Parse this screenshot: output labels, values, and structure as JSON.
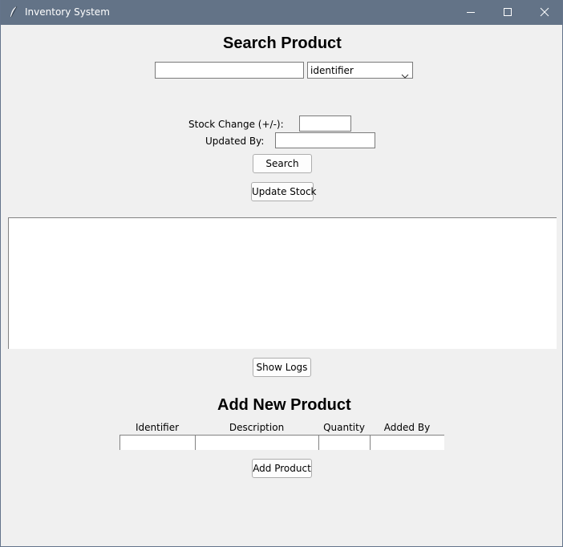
{
  "window": {
    "title": "Inventory System",
    "minimize_icon": "minimize-icon",
    "maximize_icon": "maximize-icon",
    "close_icon": "close-icon",
    "app_icon": "feather-icon",
    "titlebar_color": "#637387"
  },
  "search": {
    "heading": "Search Product",
    "query_value": "",
    "field_selected": "identifier",
    "stock_change_label": "Stock Change (+/-):",
    "stock_change_value": "",
    "updated_by_label": "Updated By:",
    "updated_by_value": "",
    "search_button": "Search",
    "update_stock_button": "Update Stock"
  },
  "results": {
    "text": ""
  },
  "logs": {
    "show_logs_button": "Show Logs"
  },
  "add_product": {
    "heading": "Add New Product",
    "columns": [
      "Identifier",
      "Description",
      "Quantity",
      "Added By"
    ],
    "values": [
      "",
      "",
      "",
      ""
    ],
    "add_button": "Add Product"
  }
}
